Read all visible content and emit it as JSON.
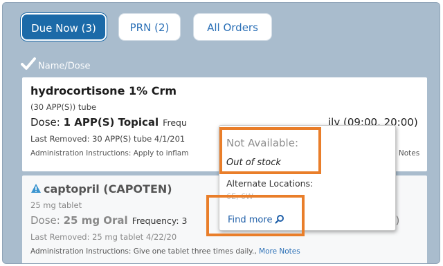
{
  "tabs": [
    {
      "label": "Due Now (3)"
    },
    {
      "label": "PRN (2)"
    },
    {
      "label": "All Orders"
    }
  ],
  "column_header": {
    "label": "Name/Dose",
    "icon": "checkmark-icon"
  },
  "meds": [
    {
      "name": "hydrocortisone 1% Crm",
      "form": "(30 APP(S)) tube",
      "dose_prefix": "Dose: ",
      "dose_value": "1 APP(S) Topical",
      "frequency": "Frequ",
      "dose_tail": "ily (09:00, 20:00)",
      "last_removed": "Last Removed: 30 APP(S) tube 4/1/201",
      "admin": "Administration Instructions: Apply to inflam",
      "admin_tail": "re Notes"
    },
    {
      "name": "captopril (CAPOTEN)",
      "form": "25 mg tablet",
      "dose_prefix": "Dose: ",
      "dose_value": "25 mg Oral",
      "frequency": "Frequency: 3",
      "dose_tail": "0)",
      "last_removed": "Last Removed: 25 mg tablet 4/22/20",
      "admin": "Administration Instructions: Give one tablet three times daily., ",
      "admin_more": "More Notes"
    }
  ],
  "popup": {
    "title": "Not Available:",
    "reason": "Out of stock",
    "alt_label": "Alternate Locations:",
    "alt_value": "6E, 6W",
    "find_more": "Find more"
  },
  "colors": {
    "accent": "#1c6aa8",
    "background": "#a9bccd",
    "highlight": "#e97e2a"
  }
}
